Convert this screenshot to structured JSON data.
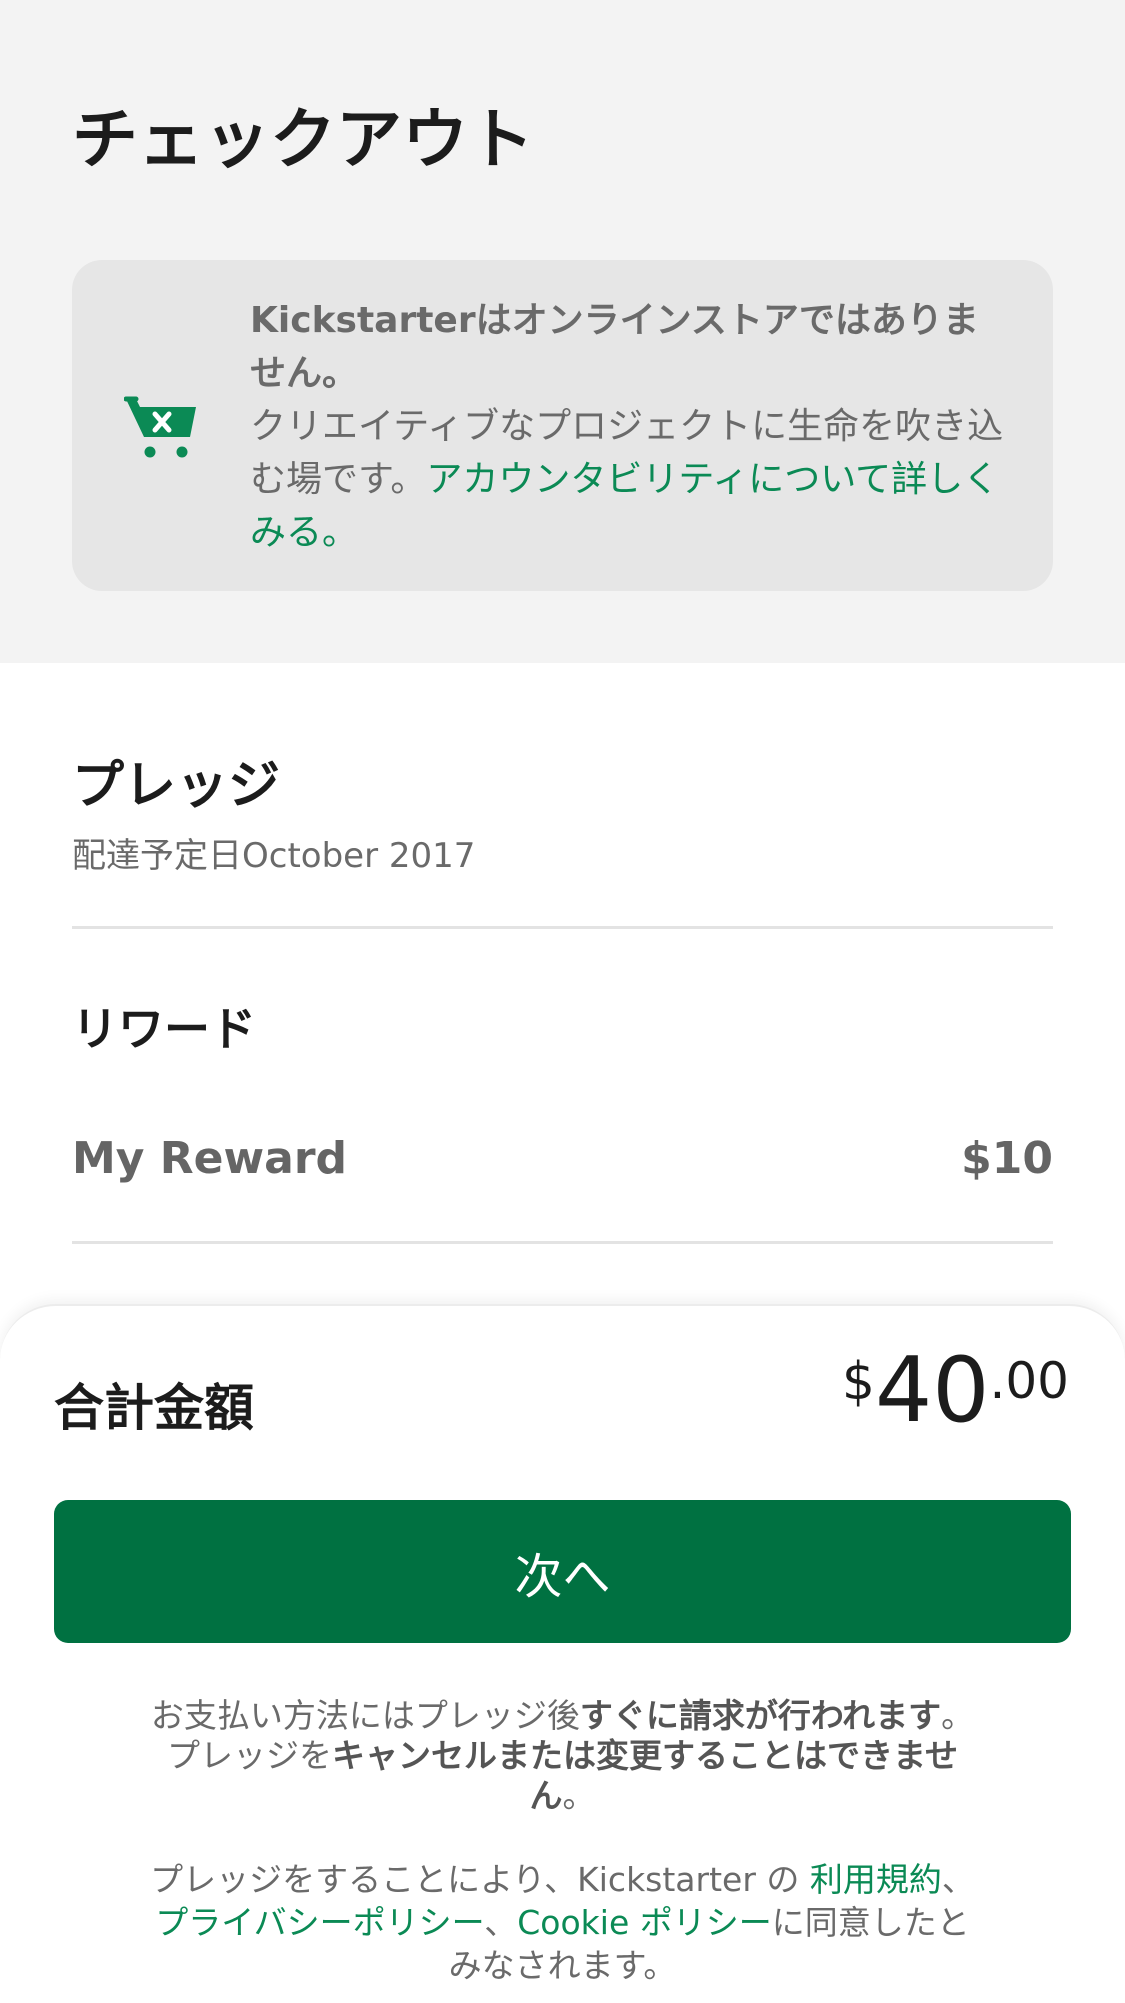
{
  "header": {
    "title": "チェックアウト"
  },
  "notice": {
    "icon": "shopping-cart-x-icon",
    "title": "Kickstarterはオンラインストアではありません。",
    "body": "クリエイティブなプロジェクトに生命を吹き込む場です。",
    "link": "アカウンタビリティについて詳しくみる。"
  },
  "pledge": {
    "title": "プレッジ",
    "delivery": "配達予定日October 2017"
  },
  "reward": {
    "heading": "リワード",
    "name": "My Reward",
    "price": "$10"
  },
  "total": {
    "label": "合計金額",
    "currency": "$",
    "integer": "40",
    "decimal": ".00"
  },
  "next_button": "次へ",
  "fine_print_1": {
    "part1": "お支払い方法にはプレッジ後",
    "bold1": "すぐに請求が行われます",
    "part2": "。プレッジを",
    "bold2": "キャンセルまたは変更することはできません",
    "part3": "。"
  },
  "fine_print_2": {
    "part1": "プレッジをすることにより、Kickstarter の ",
    "terms": "利用規約",
    "sep1": "、",
    "privacy": "プライバシーポリシー",
    "sep2": "、",
    "cookie": "Cookie ポリシー",
    "part2": "に同意したとみなされます。"
  },
  "colors": {
    "accent": "#007141",
    "link": "#0b8a55",
    "top_background": "#f3f3f3",
    "card_background": "#e6e6e6"
  }
}
